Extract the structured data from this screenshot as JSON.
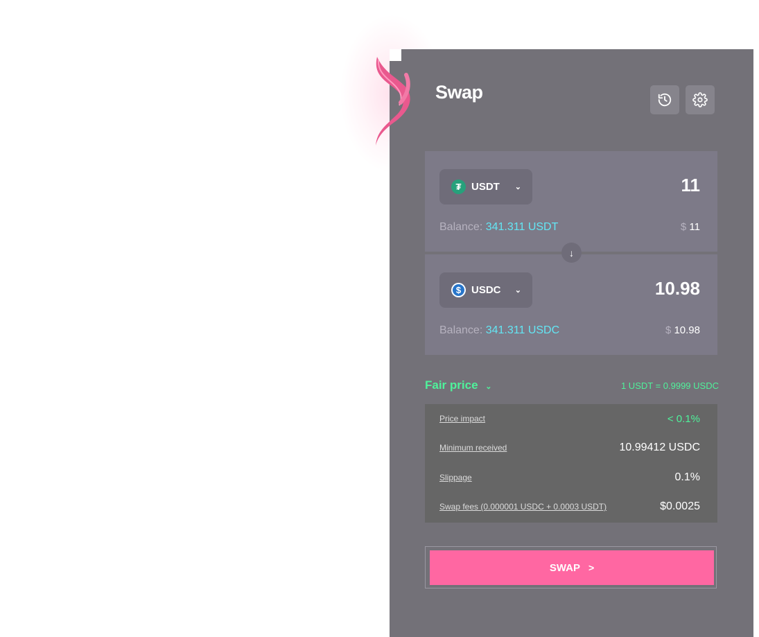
{
  "header": {
    "title": "Swap"
  },
  "from": {
    "token": "USDT",
    "token_symbol_glyph": "₮",
    "token_color": "#26a17b",
    "amount": "11",
    "balance_label": "Balance:",
    "balance_value": "341.311 USDT",
    "usd_symbol": "$",
    "usd_value": "11"
  },
  "to": {
    "token": "USDC",
    "token_symbol_glyph": "$",
    "token_color": "#2775ca",
    "amount": "10.98",
    "balance_label": "Balance:",
    "balance_value": "341.311 USDC",
    "usd_symbol": "$",
    "usd_value": "10.98"
  },
  "price": {
    "label": "Fair price",
    "rate": "1 USDT = 0.9999 USDC"
  },
  "details": [
    {
      "label": "Price impact",
      "value": "< 0.1%"
    },
    {
      "label": "Minimum received",
      "value": "10.99412 USDC"
    },
    {
      "label": "Slippage",
      "value": "0.1%"
    },
    {
      "label": "Swap fees (0.000001 USDC + 0.0003 USDT)",
      "value": "$0.0025"
    }
  ],
  "action": {
    "label": "SWAP",
    "arrow": ">"
  },
  "colors": {
    "accent": "#ff67a2",
    "positive": "#4ff29b",
    "balance": "#63e6f4",
    "panel": "#737178"
  },
  "icons": [
    "history-icon",
    "settings-gear-icon",
    "chevron-down-icon",
    "arrow-down-icon",
    "flame-icon"
  ]
}
